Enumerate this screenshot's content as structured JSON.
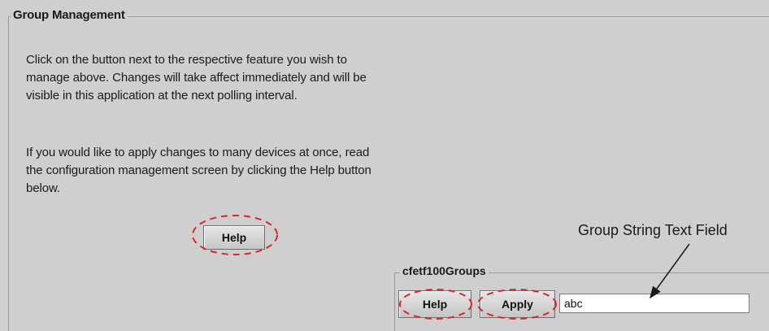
{
  "group_management": {
    "title": "Group Management",
    "paragraph1": "Click on the button next to the respective feature you wish to manage above.  Changes will take affect immediately and will be visible in this application at the next polling interval.",
    "paragraph2": "If you would like to apply changes to many devices at once, read  the configuration management screen by clicking the Help button below.",
    "help_button_label": "Help"
  },
  "groups_panel": {
    "title": "cfetf100Groups",
    "help_button_label": "Help",
    "apply_button_label": "Apply",
    "group_string_value": "abc"
  },
  "annotation": {
    "text_field_callout": "Group String Text Field",
    "highlight_color": "#d9262b"
  }
}
